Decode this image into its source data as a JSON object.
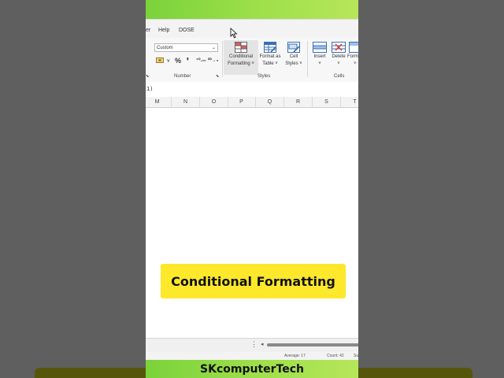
{
  "menu": {
    "items": [
      "er",
      "Help",
      "DOSE"
    ]
  },
  "ribbon": {
    "number_format_value": "Custom",
    "number_group_label": "Number",
    "percent_symbol": "%",
    "comma_symbol": "❜",
    "increase_decimal": "⁺⁰.₀₀",
    "decrease_decimal": "⁰⁰→₀",
    "styles_group_label": "Styles",
    "cells_group_label": "Cells",
    "conditional_formatting": [
      "Conditional",
      "Formatting ˅"
    ],
    "format_as_table": [
      "Format as",
      "Table ˅"
    ],
    "cell_styles": [
      "Cell",
      "Styles ˅"
    ],
    "insert": [
      "Insert",
      "˅"
    ],
    "delete": [
      "Delete",
      "˅"
    ],
    "format_partial": [
      "Form",
      "˅"
    ]
  },
  "formula_bar": {
    "text": "1)"
  },
  "columns": [
    "M",
    "N",
    "O",
    "P",
    "Q",
    "R",
    "S",
    "T"
  ],
  "caption": "Conditional Formatting",
  "status": {
    "average": "Average: 17",
    "count": "Count: 42",
    "sum_partial": "Su"
  },
  "channel_name": "SKcomputerTech",
  "colors": {
    "green_bar": "#8fd944",
    "caption_yellow": "#fde82b",
    "background": "#5f5f5f"
  }
}
